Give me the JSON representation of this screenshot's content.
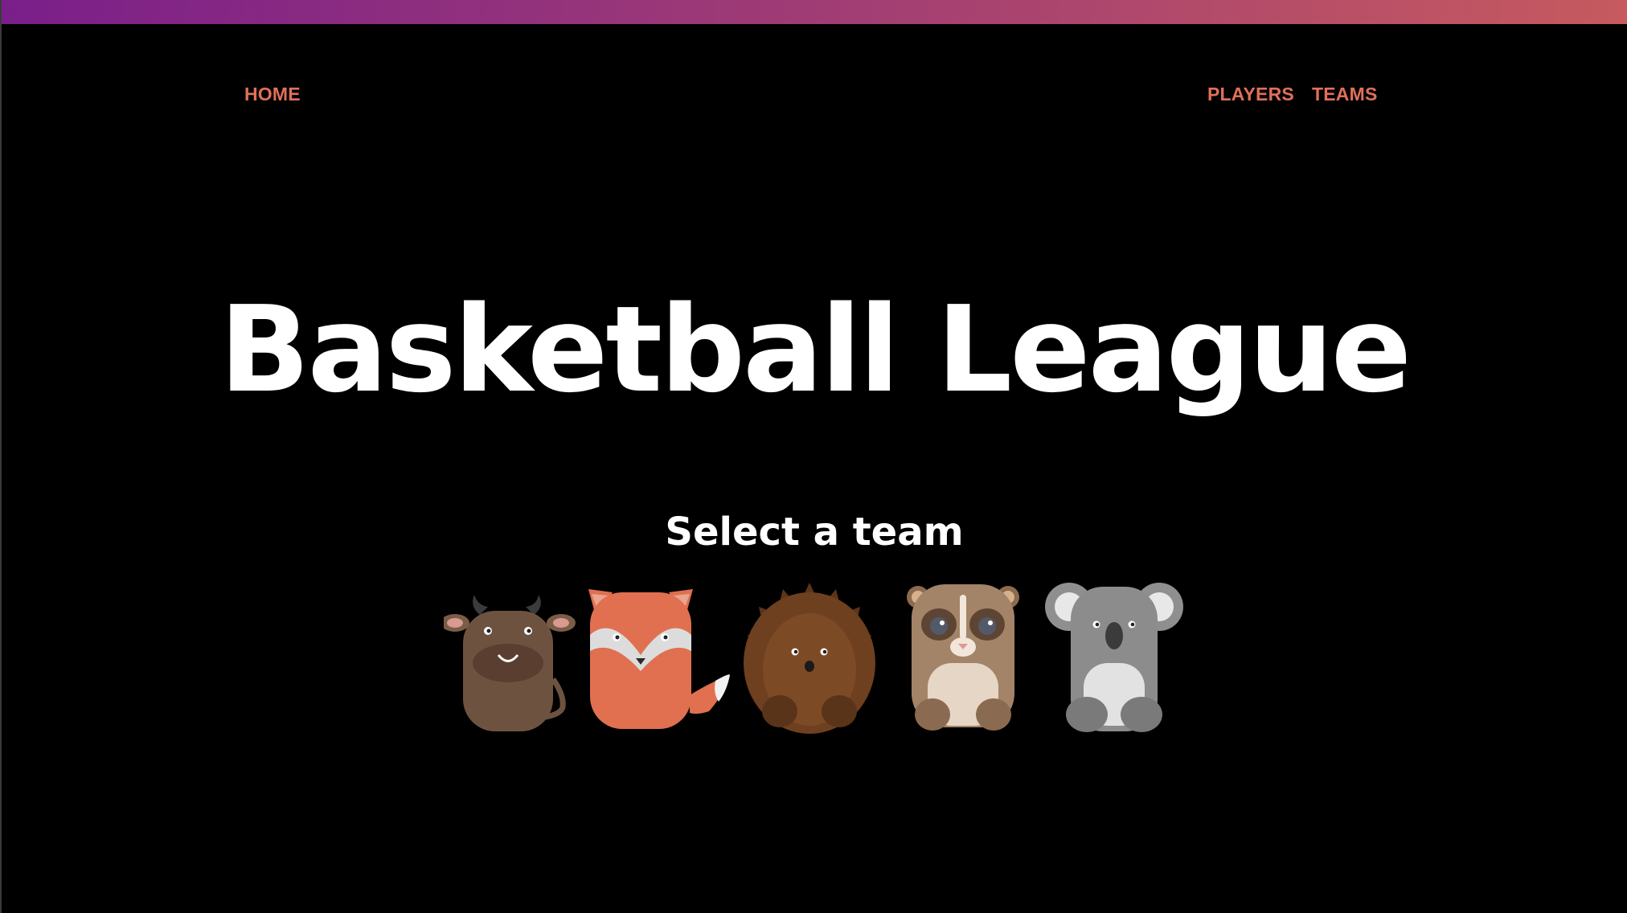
{
  "colors": {
    "background": "#000000",
    "accent": "#e0705a",
    "gradient_start": "#7a1f8a",
    "gradient_end": "#c65a5f",
    "title_text": "#ffffff"
  },
  "nav": {
    "home_label": "HOME",
    "players_label": "PLAYERS",
    "teams_label": "TEAMS"
  },
  "hero": {
    "title": "Basketball League",
    "subtitle": "Select a team"
  },
  "teams": [
    {
      "icon": "bull-icon"
    },
    {
      "icon": "fox-icon"
    },
    {
      "icon": "hedgehog-icon"
    },
    {
      "icon": "lemur-icon"
    },
    {
      "icon": "koala-icon"
    }
  ]
}
